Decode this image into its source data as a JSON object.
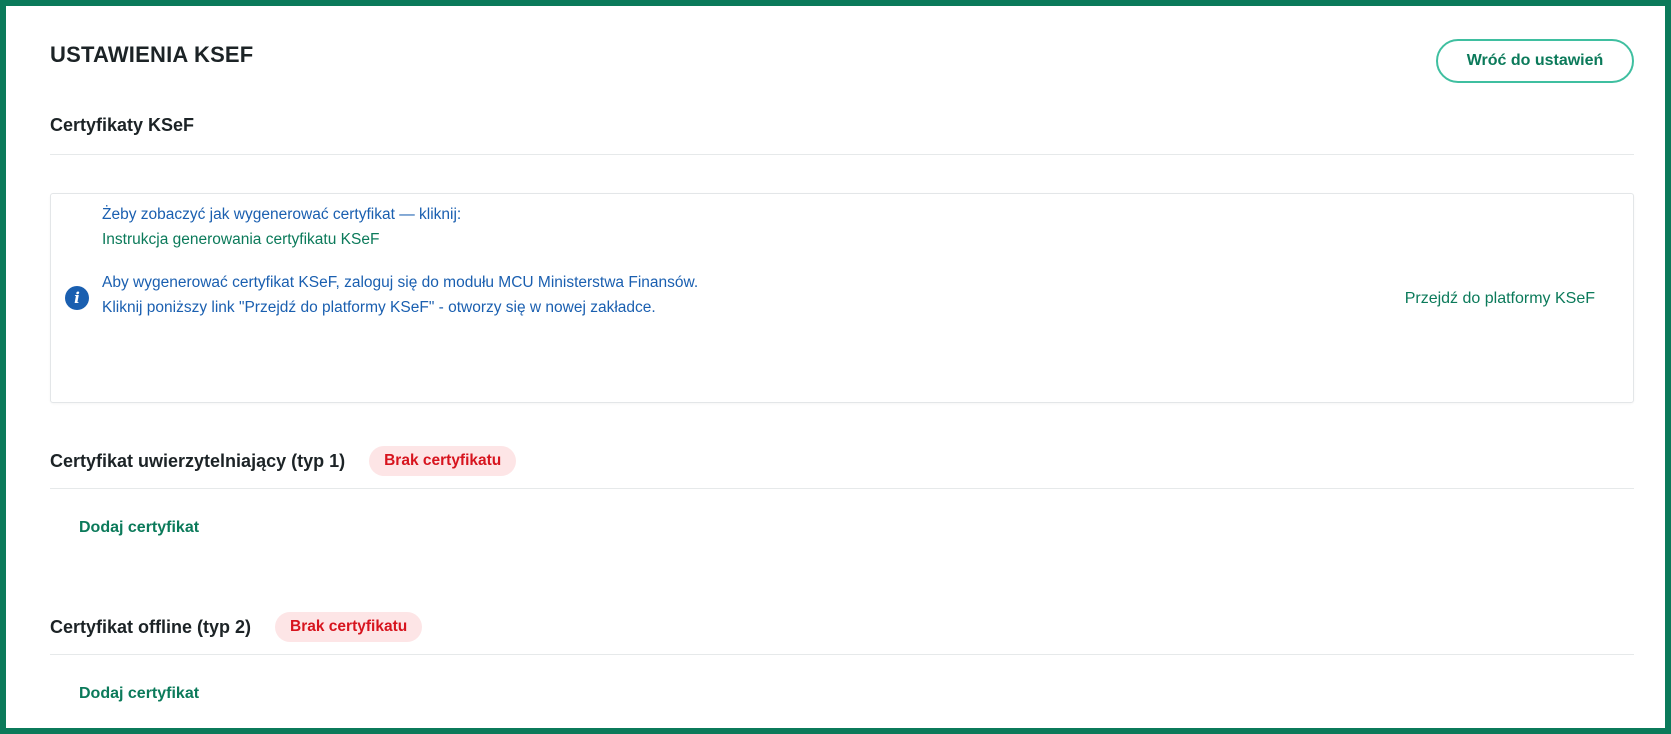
{
  "page": {
    "title": "USTAWIENIA KSEF",
    "back_button_label": "Wróć do ustawień"
  },
  "certificates_section": {
    "title": "Certyfikaty KSeF"
  },
  "info_card": {
    "line1": "Żeby zobaczyć jak wygenerować certyfikat — kliknij:",
    "instruction_link": "Instrukcja generowania certyfikatu KSeF",
    "line3": "Aby wygenerować certyfikat KSeF, zaloguj się do modułu MCU Ministerstwa Finansów.",
    "line4": "Kliknij poniższy link \"Przejdź do platformy KSeF\" - otworzy się w nowej zakładce.",
    "platform_link": "Przejdź do platformy KSeF",
    "icon": "info-icon"
  },
  "cert_type1": {
    "title": "Certyfikat uwierzytelniający (typ 1)",
    "status": "Brak certyfikatu",
    "add_label": "Dodaj certyfikat"
  },
  "cert_type2": {
    "title": "Certyfikat offline (typ 2)",
    "status": "Brak certyfikatu",
    "add_label": "Dodaj certyfikat"
  },
  "colors": {
    "frame": "#0b7a5a",
    "accent_green": "#0b7a5a",
    "button_border": "#3fbfa0",
    "info_blue": "#1a5fb0",
    "badge_bg": "#fde5e6",
    "badge_text": "#d7141e"
  }
}
